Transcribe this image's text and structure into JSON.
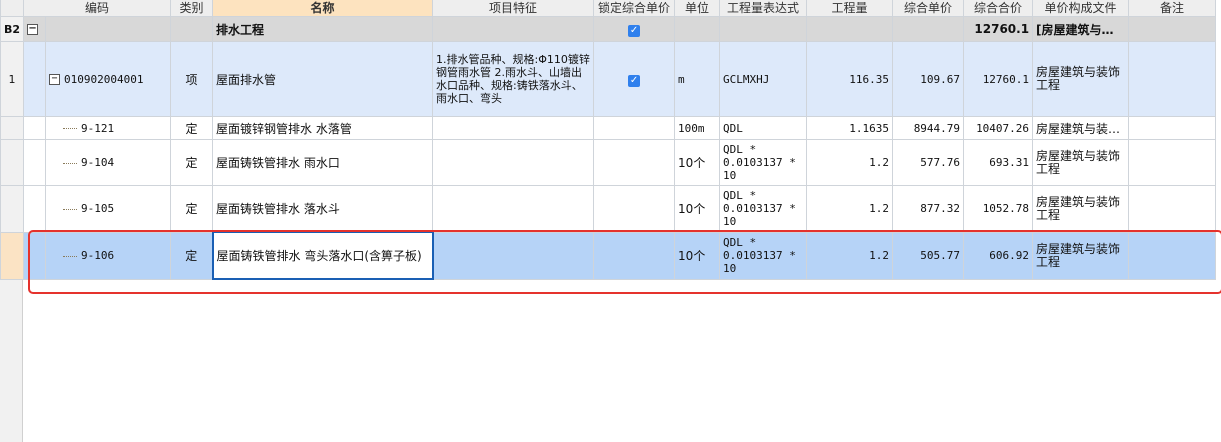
{
  "headers": [
    "编码",
    "类别",
    "名称",
    "项目特征",
    "锁定综合单价",
    "单位",
    "工程量表达式",
    "工程量",
    "综合单价",
    "综合合价",
    "单价构成文件",
    "备注"
  ],
  "section": {
    "code": "B2",
    "name": "排水工程",
    "total": "12760.1",
    "file": "[房屋建筑与…"
  },
  "item": {
    "rownum": "1",
    "code": "010902004001",
    "type": "项",
    "name": "屋面排水管",
    "feature": "1.排水管品种、规格:Φ110镀锌钢管雨水管\n2.雨水斗、山墙出水口品种、规格:铸铁落水斗、雨水口、弯头",
    "unit": "m",
    "expr": "GCLMXHJ",
    "qty": "116.35",
    "price": "109.67",
    "total": "12760.1",
    "file": "房屋建筑与装饰工程"
  },
  "subs": [
    {
      "code": "9-121",
      "type": "定",
      "name": "屋面镀锌钢管排水 水落管",
      "unit": "100m",
      "expr": "QDL",
      "qty": "1.1635",
      "price": "8944.79",
      "total": "10407.26",
      "file": "房屋建筑与装…"
    },
    {
      "code": "9-104",
      "type": "定",
      "name": "屋面铸铁管排水 雨水口",
      "unit": "10个",
      "expr": "QDL *\n0.0103137 *\n10",
      "qty": "1.2",
      "price": "577.76",
      "total": "693.31",
      "file": "房屋建筑与装饰工程"
    },
    {
      "code": "9-105",
      "type": "定",
      "name": "屋面铸铁管排水 落水斗",
      "unit": "10个",
      "expr": "QDL *\n0.0103137 *\n10",
      "qty": "1.2",
      "price": "877.32",
      "total": "1052.78",
      "file": "房屋建筑与装饰工程"
    },
    {
      "code": "9-106",
      "type": "定",
      "name": "屋面铸铁管排水 弯头落水口(含箅子板)",
      "unit": "10个",
      "expr": "QDL *\n0.0103137 *\n10",
      "qty": "1.2",
      "price": "505.77",
      "total": "606.92",
      "file": "房屋建筑与装饰工程"
    }
  ],
  "colors": {
    "header": "#eeeeee",
    "name_header": "#fde3bf",
    "item_row": "#dde9fa",
    "selected_row": "#b6d3f7",
    "outline": "#e5322d"
  }
}
